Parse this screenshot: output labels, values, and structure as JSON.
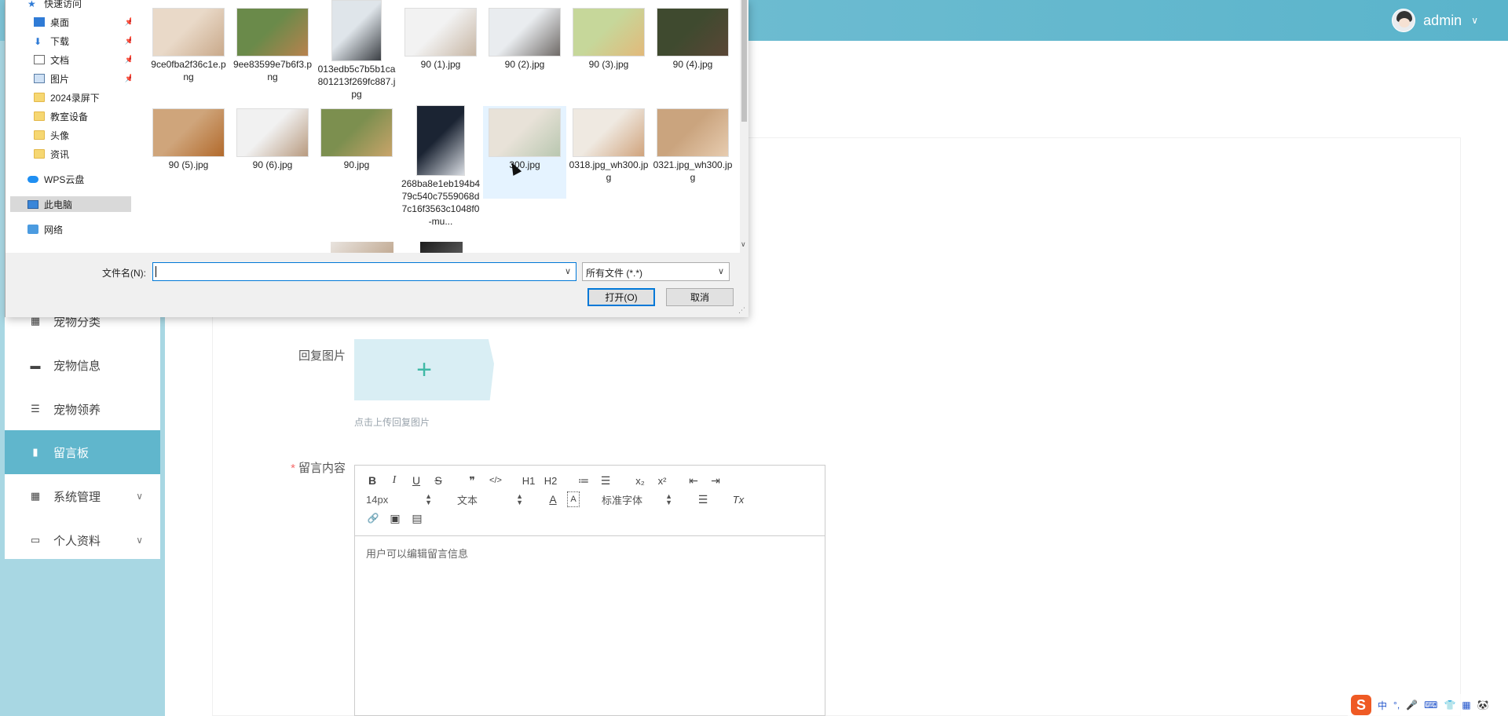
{
  "header": {
    "username": "admin",
    "chevron": "∨",
    "avatar_icon": "avatar-icon"
  },
  "sidebar": {
    "items": [
      {
        "label": "宠物分类",
        "icon": "grid-icon",
        "active": false,
        "has_arrow": false
      },
      {
        "label": "宠物信息",
        "icon": "briefcase-icon",
        "active": false,
        "has_arrow": false
      },
      {
        "label": "宠物领养",
        "icon": "list-icon",
        "active": false,
        "has_arrow": false
      },
      {
        "label": "留言板",
        "icon": "bar-chart-icon",
        "active": true,
        "has_arrow": false
      },
      {
        "label": "系统管理",
        "icon": "grid-icon",
        "active": false,
        "has_arrow": true
      },
      {
        "label": "个人资料",
        "icon": "id-card-icon",
        "active": false,
        "has_arrow": true
      }
    ]
  },
  "form": {
    "reply_image_label": "回复图片",
    "upload_tip": "点击上传回复图片",
    "content_label": "留言内容",
    "required_mark": "*",
    "editor": {
      "font_size": "14px",
      "paragraph": "文本",
      "font_family": "标准字体",
      "placeholder": "用户可以编辑留言信息",
      "h1": "H1",
      "h2": "H2",
      "bold": "B",
      "italic": "I",
      "underline": "U",
      "strike": "S",
      "quote": "❞",
      "code": "</>",
      "ordered_list": "≔",
      "bullet_list": "☰",
      "subscript": "x₂",
      "superscript": "x²",
      "outdent": "⇤",
      "indent": "⇥",
      "font_color": "A",
      "background": "A",
      "align": "☰",
      "clean": "Tx",
      "link": "🔗",
      "image": "▣",
      "video": "▤"
    }
  },
  "dialog": {
    "nav": [
      {
        "label": "快速访问",
        "icon": "star-icon",
        "pinned": false
      },
      {
        "label": "桌面",
        "icon": "desktop-icon",
        "pinned": true
      },
      {
        "label": "下载",
        "icon": "download-icon",
        "pinned": true
      },
      {
        "label": "文档",
        "icon": "document-icon",
        "pinned": true
      },
      {
        "label": "图片",
        "icon": "picture-icon",
        "pinned": true
      },
      {
        "label": "2024录屏下",
        "icon": "folder-icon",
        "pinned": false
      },
      {
        "label": "教室设备",
        "icon": "folder-icon",
        "pinned": false
      },
      {
        "label": "头像",
        "icon": "folder-icon",
        "pinned": false
      },
      {
        "label": "资讯",
        "icon": "folder-icon",
        "pinned": false
      },
      {
        "label": "WPS云盘",
        "icon": "cloud-icon",
        "pinned": false
      },
      {
        "label": "此电脑",
        "icon": "computer-icon",
        "pinned": false,
        "selected": true
      },
      {
        "label": "网络",
        "icon": "network-icon",
        "pinned": false
      }
    ],
    "pin_glyph": "📌",
    "files": [
      {
        "name": "9ce0fba2f36c1e.png",
        "colors": [
          "#e9d9c8",
          "#c9a98a"
        ]
      },
      {
        "name": "9ee83599e7b6f3.png",
        "colors": [
          "#6a8a4a",
          "#b8824e"
        ]
      },
      {
        "name": "013edb5c7b5b1ca801213f269fc887.jpg",
        "colors": [
          "#dfe5ea",
          "#3b3f44"
        ]
      },
      {
        "name": "90 (1).jpg",
        "colors": [
          "#f2f2f2",
          "#c7b6a4"
        ]
      },
      {
        "name": "90 (2).jpg",
        "colors": [
          "#e9ecef",
          "#6f6a67"
        ]
      },
      {
        "name": "90 (3).jpg",
        "colors": [
          "#c6d79a",
          "#e2b97a"
        ]
      },
      {
        "name": "90 (4).jpg",
        "colors": [
          "#3f4a2f",
          "#5a4636"
        ]
      },
      {
        "name": "90 (5).jpg",
        "colors": [
          "#cfa57b",
          "#b26a2c"
        ]
      },
      {
        "name": "90 (6).jpg",
        "colors": [
          "#f1f1f1",
          "#b89a7f"
        ]
      },
      {
        "name": "90.jpg",
        "colors": [
          "#7c8f4f",
          "#c9a46a"
        ]
      },
      {
        "name": "268ba8e1eb194b479c540c7559068d7c16f3563c1048f0-mu...",
        "colors": [
          "#1b2433",
          "#d9dde3"
        ]
      },
      {
        "name": "300.jpg",
        "colors": [
          "#e8e2d8",
          "#b9c7b0"
        ]
      },
      {
        "name": "0318.jpg_wh300.jpg",
        "colors": [
          "#efe9e1",
          "#d0a37c"
        ]
      },
      {
        "name": "0321.jpg_wh300.jpg",
        "colors": [
          "#caa47e",
          "#e7ccb0"
        ]
      }
    ],
    "partial_row": [
      {
        "colors": [
          "#e9e4df",
          "#c0a890"
        ]
      },
      {
        "colors": [
          "#1c1c1c",
          "#5a5a5a"
        ]
      }
    ],
    "filename_label": "文件名(N):",
    "filename_value": "",
    "filetype": "所有文件 (*.*)",
    "open_button": "打开(O)",
    "cancel_button": "取消",
    "dropdown_glyph": "∨",
    "scroll_down_glyph": "∨",
    "grip_glyph": "⋰"
  },
  "tray": {
    "ime_logo": "S",
    "ime_lang": "中",
    "items": [
      "°,",
      "🎤",
      "⌨",
      "👕",
      "▦",
      "🐼"
    ]
  }
}
